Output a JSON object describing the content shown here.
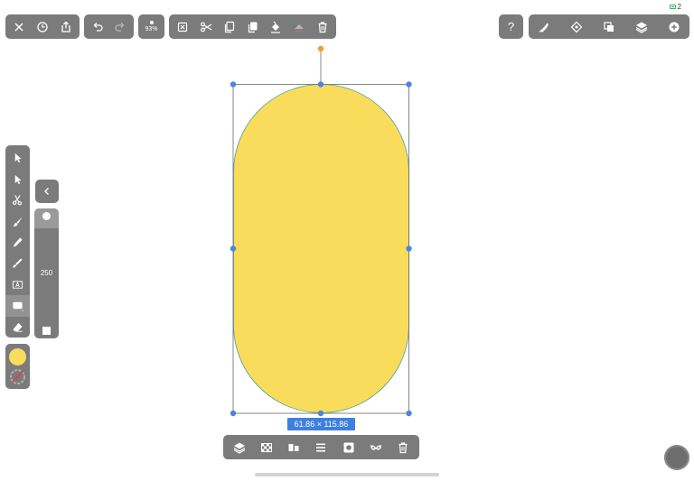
{
  "status": {
    "battery_level": "2"
  },
  "toolbar_file": {
    "icons": [
      "close-icon",
      "clock-icon",
      "share-icon"
    ]
  },
  "toolbar_history": {
    "icons": [
      "undo-icon",
      "redo-icon"
    ]
  },
  "zoom": {
    "value": "93%"
  },
  "toolbar_edit": {
    "icons": [
      "deselect-icon",
      "cut-icon",
      "copy-icon",
      "paste-icon",
      "paint-bucket-icon",
      "erase-fill-icon",
      "trash-icon"
    ]
  },
  "help": {
    "label": "?"
  },
  "toolbar_right": {
    "icons": [
      "pen-style-icon",
      "transform-icon",
      "arrange-icon",
      "layers-icon",
      "add-icon"
    ]
  },
  "tools": [
    "select-arrow-icon",
    "direct-select-icon",
    "scissors-icon",
    "brush-icon",
    "pencil-icon",
    "marker-icon",
    "text-icon",
    "rectangle-icon",
    "eraser-icon"
  ],
  "active_tool": "rectangle-icon",
  "colors": {
    "fill": "#f9dc5c",
    "stroke": "none"
  },
  "size_slider": {
    "value": "250"
  },
  "selection": {
    "dimensions": "61.86 × 115.86"
  },
  "toolbar_shape": {
    "icons": [
      "layer-stack-icon",
      "checker-icon",
      "align-icon",
      "distribute-icon",
      "mask-icon",
      "glasses-icon",
      "trash-icon"
    ]
  },
  "accent": "#3f7fe0",
  "handle_color": "#4a86e0",
  "rotate_handle_color": "#f0a030"
}
